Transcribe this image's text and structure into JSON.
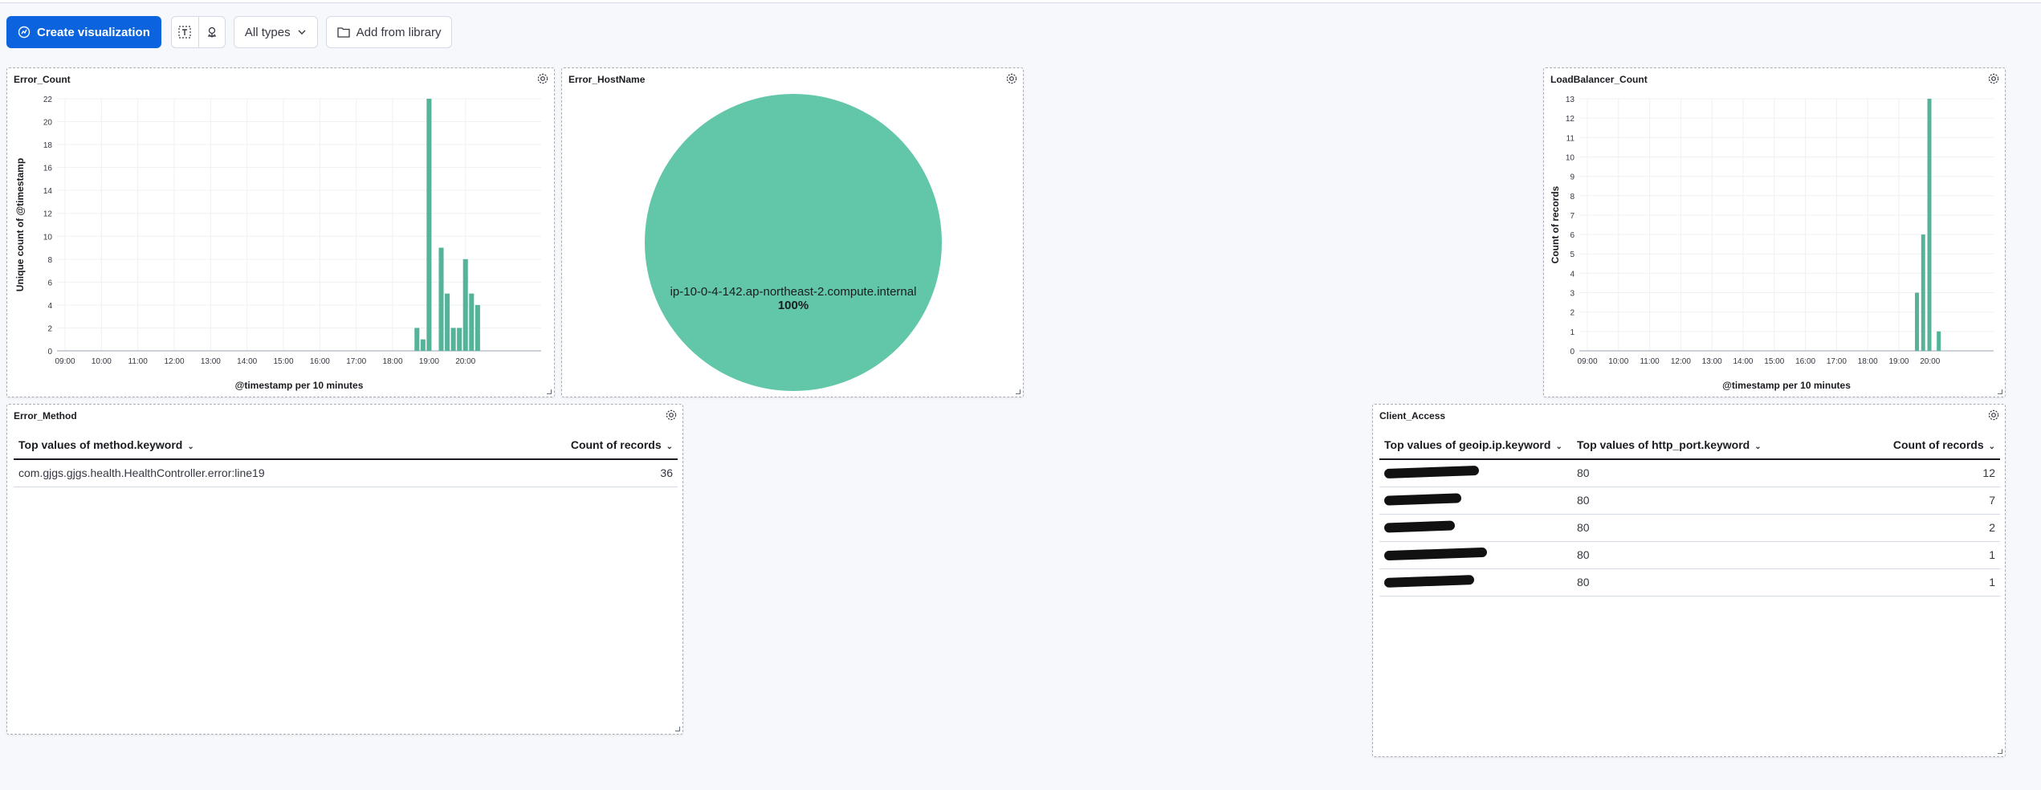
{
  "toolbar": {
    "create_label": "Create visualization",
    "types_label": "All types",
    "library_label": "Add from library"
  },
  "panels": {
    "error_count": {
      "title": "Error_Count"
    },
    "error_hostname": {
      "title": "Error_HostName"
    },
    "loadbalancer_count": {
      "title": "LoadBalancer_Count"
    },
    "error_method": {
      "title": "Error_Method",
      "columns": [
        "Top values of method.keyword",
        "Count of records"
      ],
      "rows": [
        {
          "method": "com.gjgs.gjgs.health.HealthController.error:line19",
          "count": "36"
        }
      ]
    },
    "client_access": {
      "title": "Client_Access",
      "columns": [
        "Top values of geoip.ip.keyword",
        "Top values of http_port.keyword",
        "Count of records"
      ],
      "rows": [
        {
          "ip": "",
          "port": "80",
          "count": "12"
        },
        {
          "ip": "",
          "port": "80",
          "count": "7"
        },
        {
          "ip": "",
          "port": "80",
          "count": "2"
        },
        {
          "ip": "",
          "port": "80",
          "count": "1"
        },
        {
          "ip": "",
          "port": "80",
          "count": "1"
        }
      ]
    }
  },
  "chart_data": [
    {
      "type": "bar",
      "xlabel": "@timestamp per 10 minutes",
      "ylabel": "Unique count of @timestamp",
      "x_ticks": [
        "09:00",
        "10:00",
        "11:00",
        "12:00",
        "13:00",
        "14:00",
        "15:00",
        "16:00",
        "17:00",
        "18:00",
        "19:00",
        "20:00"
      ],
      "y_ticks": [
        0,
        2,
        4,
        6,
        8,
        10,
        12,
        14,
        16,
        18,
        20,
        22
      ],
      "ylim": [
        0,
        22
      ],
      "grid": true,
      "color": "#54b399",
      "x": [
        "18:50",
        "18:60",
        "19:00",
        "19:10",
        "19:20",
        "19:30",
        "19:40",
        "19:50",
        "20:00",
        "20:10",
        "20:20"
      ],
      "values": [
        2,
        1,
        22,
        0,
        9,
        5,
        2,
        2,
        8,
        5,
        4
      ]
    },
    {
      "type": "pie",
      "slices": [
        {
          "label": "ip-10-0-4-142.ap-northeast-2.compute.internal",
          "value": 100,
          "percent_label": "100%",
          "color": "#62c6a8"
        }
      ]
    },
    {
      "type": "bar",
      "xlabel": "@timestamp per 10 minutes",
      "ylabel": "Count of records",
      "x_ticks": [
        "09:00",
        "10:00",
        "11:00",
        "12:00",
        "13:00",
        "14:00",
        "15:00",
        "16:00",
        "17:00",
        "18:00",
        "19:00",
        "20:00"
      ],
      "y_ticks": [
        0,
        1,
        2,
        3,
        4,
        5,
        6,
        7,
        8,
        9,
        10,
        11,
        12,
        13
      ],
      "ylim": [
        0,
        13
      ],
      "grid": true,
      "color": "#54b399",
      "values_by_slot": [
        {
          "slot": 10.6,
          "value": 3
        },
        {
          "slot": 10.8,
          "value": 6
        },
        {
          "slot": 11.0,
          "value": 13
        },
        {
          "slot": 11.3,
          "value": 1
        }
      ]
    }
  ]
}
